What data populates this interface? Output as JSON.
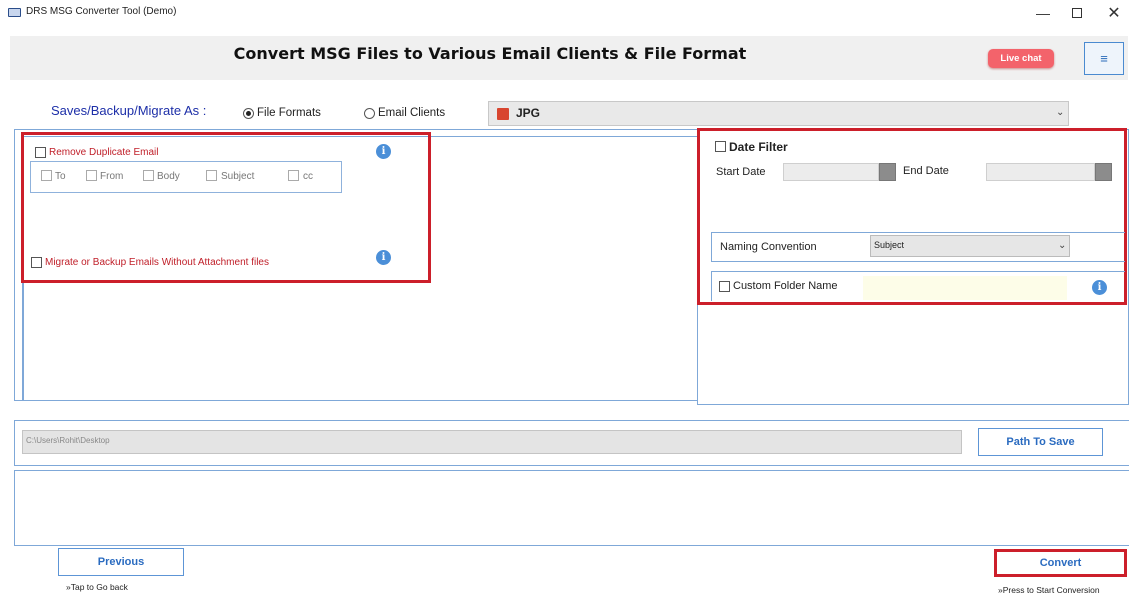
{
  "window": {
    "title": "DRS MSG Converter Tool (Demo)",
    "minimize": "—",
    "close": "✕"
  },
  "header": {
    "title": "Convert MSG Files to Various Email Clients & File Format",
    "live_chat": "Live chat",
    "menu_icon": "≡"
  },
  "save_as": {
    "label": "Saves/Backup/Migrate As :",
    "options": [
      "File Formats",
      "Email Clients"
    ],
    "selected": "File Formats",
    "format": "JPG",
    "format_icon": "pdf-file-icon"
  },
  "left_panel": {
    "remove_duplicate": "Remove Duplicate Email",
    "fields": [
      "To",
      "From",
      "Body",
      "Subject",
      "cc"
    ],
    "migrate_without_attachment": "Migrate or Backup Emails Without Attachment files",
    "info": "i"
  },
  "right_panel": {
    "date_filter": "Date Filter",
    "start_date": "Start Date",
    "end_date": "End Date",
    "naming_convention": "Naming Convention",
    "naming_value": "Subject",
    "custom_folder": "Custom Folder Name",
    "info": "i"
  },
  "path": {
    "value": "C:\\Users\\Rohit\\Desktop",
    "button": "Path To Save"
  },
  "footer": {
    "previous": "Previous",
    "previous_hint": "»Tap to Go back",
    "convert": "Convert",
    "convert_hint": "»Press to Start Conversion"
  },
  "colors": {
    "highlight_red": "#cc1f2a",
    "accent_blue": "#2a6bc0",
    "live_chat": "#f3636b",
    "label_blue": "#1d2fa8"
  }
}
